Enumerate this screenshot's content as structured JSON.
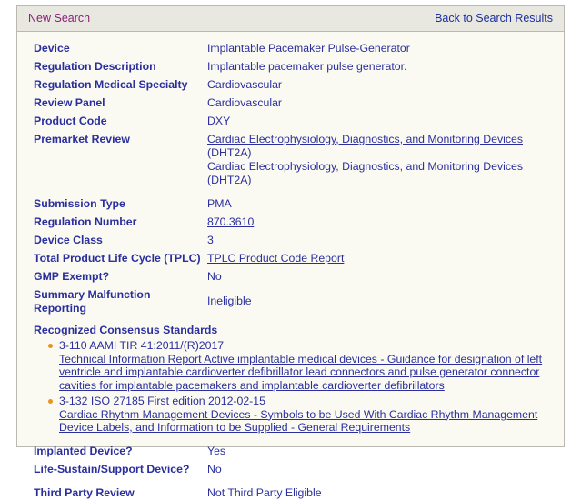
{
  "nav": {
    "new_search": "New Search",
    "back_to_results": "Back to Search Results",
    "colors": {
      "new_search": "#8b1f7a",
      "back_to_results": "#1c2f9c",
      "bar_background": "#e8e8e0",
      "panel_background": "#fafaf2",
      "border": "#b9b9b0",
      "text": "#2b2f9e",
      "bullet": "#e8951f"
    }
  },
  "details": {
    "rows": [
      {
        "label": "Device",
        "value": "Implantable Pacemaker Pulse-Generator"
      },
      {
        "label": "Regulation Description",
        "value": "Implantable pacemaker pulse generator."
      },
      {
        "label": "Regulation Medical Specialty",
        "value": "Cardiovascular"
      },
      {
        "label": "Review Panel",
        "value": "Cardiovascular"
      },
      {
        "label": "Product Code",
        "value": "DXY"
      }
    ],
    "premarket_review": {
      "label": "Premarket Review",
      "line1_link": "Cardiac Electrophysiology, Diagnostics, and Monitoring Devices",
      "line1_suffix": " (DHT2A)",
      "line2": "Cardiac Electrophysiology, Diagnostics, and Monitoring Devices (DHT2A)"
    },
    "rows2": [
      {
        "label": "Submission Type",
        "value": "PMA",
        "link": false
      },
      {
        "label": "Regulation Number",
        "value": "870.3610",
        "link": true
      },
      {
        "label": "Device Class",
        "value": "3",
        "link": false
      },
      {
        "label": "Total Product Life Cycle (TPLC)",
        "value": "TPLC Product Code Report",
        "link": true
      },
      {
        "label": "GMP Exempt?",
        "value": "No",
        "link": false
      }
    ],
    "summary_malfunction": {
      "label_line1": "Summary Malfunction",
      "label_line2": "Reporting",
      "value": "Ineligible"
    },
    "consensus": {
      "heading": "Recognized Consensus Standards",
      "items": [
        {
          "title": "3-110 AAMI TIR 41:2011/(R)2017",
          "description": "Technical Information Report Active implantable medical devices - Guidance for designation of left ventricle and implantable cardioverter defibrillator lead connectors and pulse generator connector cavities for implantable pacemakers and implantable cardioverter defibrillators"
        },
        {
          "title": "3-132 ISO 27185 First edition 2012-02-15",
          "description": "Cardiac Rhythm Management Devices - Symbols to be Used With Cardiac Rhythm Management Device Labels, and Information to be Supplied - General Requirements"
        }
      ]
    },
    "rows3": [
      {
        "label": "Implanted Device?",
        "value": "Yes"
      },
      {
        "label": "Life-Sustain/Support Device?",
        "value": "No"
      },
      {
        "label": "Third Party Review",
        "value": "Not Third Party Eligible"
      }
    ]
  }
}
